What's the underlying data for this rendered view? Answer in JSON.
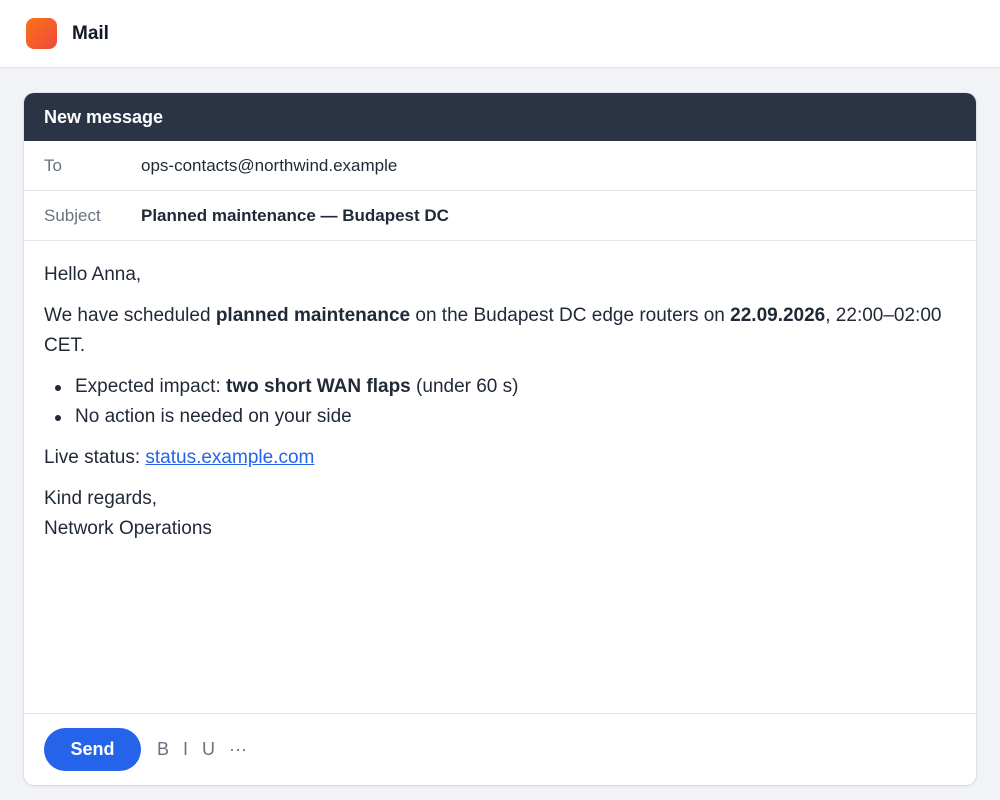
{
  "app": {
    "title": "Mail"
  },
  "composer": {
    "title": "New message",
    "to_label": "To",
    "to_value": "ops-contacts@northwind.example",
    "subject_label": "Subject",
    "subject_value": "Planned maintenance — Budapest DC"
  },
  "body": {
    "greeting": "Hello Anna,",
    "p1_a": "We have scheduled ",
    "p1_b": "planned maintenance",
    "p1_c": " on the Budapest DC edge routers on ",
    "p1_d": "22.09.2026",
    "p1_e": ", 22:00–02:00 CET.",
    "bullet1_a": "Expected impact: ",
    "bullet1_b": "two short WAN flaps",
    "bullet1_c": " (under 60 s)",
    "bullet2": "No action is needed on your side",
    "status_label": "Live status: ",
    "status_link": "status.example.com",
    "closing": "Kind regards,",
    "signature": "Network Operations"
  },
  "footer": {
    "send_label": "Send",
    "bold_label": "B",
    "italic_label": "I",
    "underline_label": "U",
    "more_label": "···"
  },
  "colors": {
    "accent": "#2563eb",
    "header_dark": "#2b3445",
    "logo_gradient": [
      "#f97316",
      "#f0483e"
    ]
  }
}
